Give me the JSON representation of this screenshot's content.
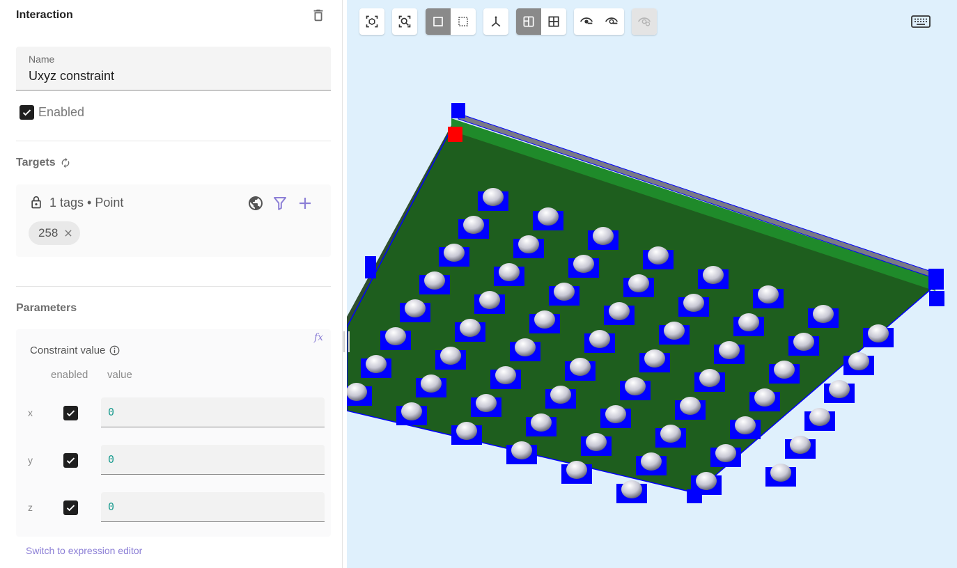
{
  "panel": {
    "title": "Interaction",
    "name_label": "Name",
    "name_value": "Uxyz constraint",
    "enabled_label": "Enabled",
    "enabled": true
  },
  "targets": {
    "title": "Targets",
    "summary": "1 tags • Point",
    "chips": [
      "258"
    ]
  },
  "parameters": {
    "title": "Parameters",
    "constraint_label": "Constraint value",
    "col_enabled": "enabled",
    "col_value": "value",
    "rows": [
      {
        "axis": "x",
        "enabled": true,
        "value": "0"
      },
      {
        "axis": "y",
        "enabled": true,
        "value": "0"
      },
      {
        "axis": "z",
        "enabled": true,
        "value": "0"
      }
    ],
    "switch_link": "Switch to expression editor"
  },
  "colors": {
    "viewport_bg": "#dff0fc",
    "plate_green": "#1e5e1e",
    "edge_green": "#1f8a2a",
    "constraint_blue": "#0000ff",
    "selected_red": "#ff0000",
    "accent_purple": "#8c7fd6",
    "value_teal": "#1a9b8f"
  },
  "icons": {
    "trash": "trash-icon",
    "refresh": "refresh-icon",
    "lock": "lock-icon",
    "globe": "globe-icon",
    "filter": "filter-icon",
    "add": "plus-icon",
    "remove_chip": "close-icon",
    "formula": "fx-icon",
    "info": "info-icon",
    "keyboard": "keyboard-icon"
  }
}
